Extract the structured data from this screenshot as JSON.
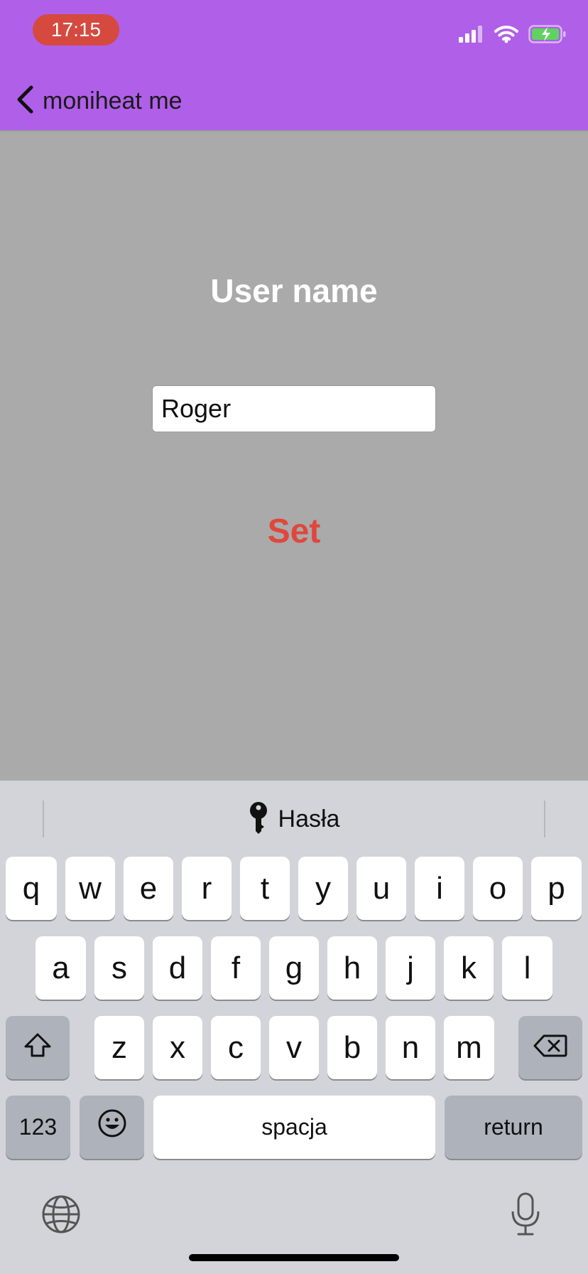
{
  "status_bar": {
    "time": "17:15"
  },
  "header": {
    "back_title": "moniheat me"
  },
  "main": {
    "label": "User name",
    "input_value": "Roger",
    "set_label": "Set"
  },
  "keyboard": {
    "suggestion": "Hasła",
    "row1": [
      "q",
      "w",
      "e",
      "r",
      "t",
      "y",
      "u",
      "i",
      "o",
      "p"
    ],
    "row2": [
      "a",
      "s",
      "d",
      "f",
      "g",
      "h",
      "j",
      "k",
      "l"
    ],
    "row3": [
      "z",
      "x",
      "c",
      "v",
      "b",
      "n",
      "m"
    ],
    "numbers_label": "123",
    "space_label": "spacja",
    "return_label": "return"
  },
  "colors": {
    "header_bg": "#b05fe8",
    "time_pill": "#d5493f",
    "page_bg": "#aaaaaa",
    "set_button": "#e0473c",
    "keyboard_bg": "#d3d4d9"
  }
}
